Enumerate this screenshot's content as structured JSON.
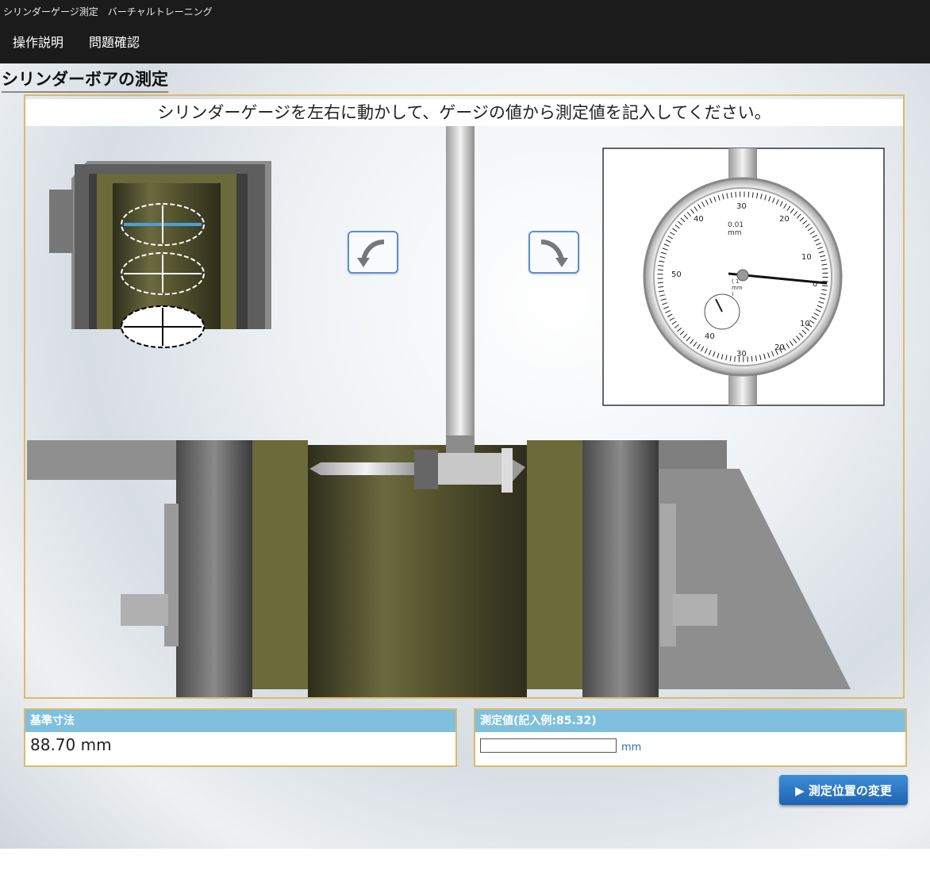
{
  "window": {
    "title": "シリンダーゲージ測定　バーチャルトレーニング"
  },
  "menu": {
    "items": [
      {
        "label": "操作説明"
      },
      {
        "label": "問題確認"
      }
    ]
  },
  "page": {
    "title": "シリンダーボアの測定"
  },
  "instruction": "シリンダーゲージを左右に動かして、ゲージの値から測定値を記入してください。",
  "dial": {
    "unit_label": "0.01 mm",
    "sub_label": "( 1 mm )",
    "scale_labels": [
      "0",
      "10",
      "20",
      "30",
      "40",
      "50",
      "40",
      "30",
      "20",
      "10"
    ],
    "needle_reading": 2
  },
  "reference": {
    "label": "基準寸法",
    "value": "88.70 mm"
  },
  "measurement": {
    "label": "測定値(記入例:85.32)",
    "value": "",
    "placeholder": "",
    "unit": "mm"
  },
  "actions": {
    "change_position": "▶ 測定位置の変更"
  },
  "colors": {
    "accent": "#7ec0de",
    "frame": "#e0b868",
    "button": "#1f63b2",
    "bore": "#6b6a3f"
  }
}
